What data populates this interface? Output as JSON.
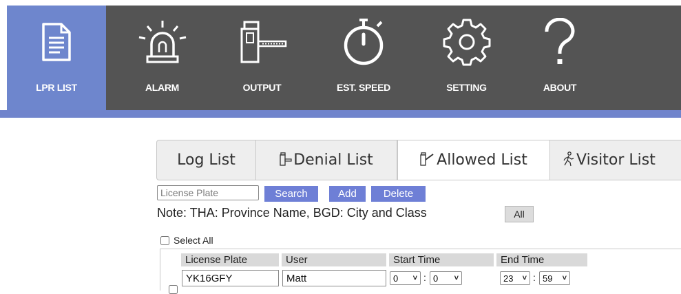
{
  "nav": {
    "items": [
      {
        "label": "LPR LIST",
        "icon": "document-icon"
      },
      {
        "label": "ALARM",
        "icon": "alarm-light-icon"
      },
      {
        "label": "OUTPUT",
        "icon": "barrier-gate-icon"
      },
      {
        "label": "EST. SPEED",
        "icon": "stopwatch-icon"
      },
      {
        "label": "SETTING",
        "icon": "gear-icon"
      },
      {
        "label": "ABOUT",
        "icon": "question-icon"
      }
    ],
    "active_index": 0,
    "colors": {
      "bar": "#545454",
      "active": "#6e86cd",
      "strip": "#7084cc"
    }
  },
  "tabs": [
    {
      "label": "Log List",
      "icon": ""
    },
    {
      "label": "Denial List",
      "icon": "barrier-gate-icon"
    },
    {
      "label": "Allowed List",
      "icon": "barrier-open-icon"
    },
    {
      "label": "Visitor List",
      "icon": "walker-icon"
    }
  ],
  "active_tab": 2,
  "search": {
    "placeholder": "License Plate",
    "value": "",
    "search_label": "Search",
    "add_label": "Add",
    "delete_label": "Delete"
  },
  "note": "Note: THA: Province Name, BGD: City and Class",
  "all_label": "All",
  "select_all_label": "Select All",
  "table": {
    "columns": [
      "License Plate",
      "User",
      "Start Time",
      "End Time"
    ],
    "rows": [
      {
        "license_plate": "YK16GFY",
        "user": "Matt",
        "start_hour": "0",
        "start_minute": "0",
        "end_hour": "23",
        "end_minute": "59",
        "checked": false
      }
    ]
  },
  "colon": ":",
  "button_color": "#6e7fd6"
}
